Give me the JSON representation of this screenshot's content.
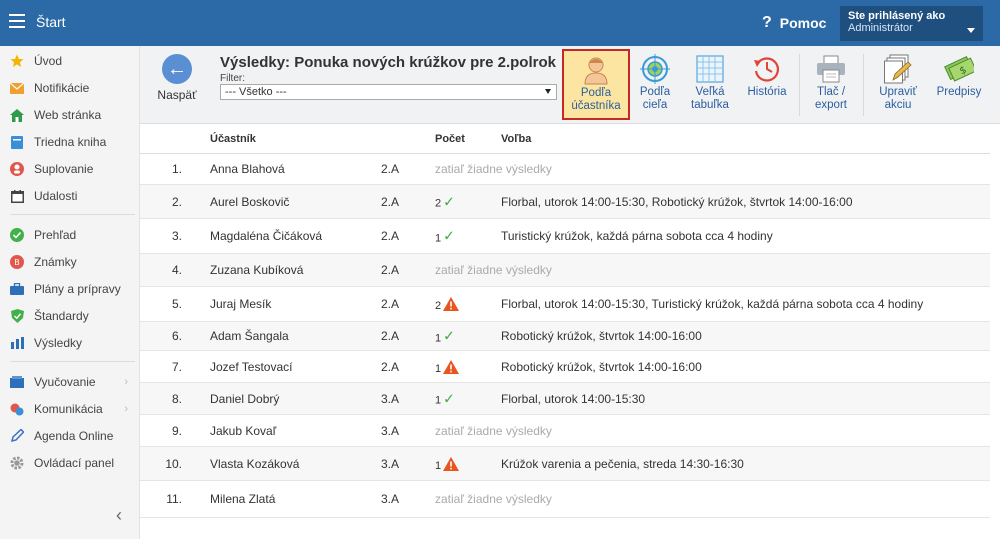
{
  "topbar": {
    "app_title": "Štart",
    "help_label": "Pomoc",
    "user_line1": "Ste prihlásený ako",
    "user_line2": "Administrátor"
  },
  "sidebar": {
    "items": [
      {
        "label": "Úvod",
        "icon": "star-icon"
      },
      {
        "label": "Notifikácie",
        "icon": "envelope-icon"
      },
      {
        "label": "Web stránka",
        "icon": "home-icon"
      },
      {
        "label": "Triedna kniha",
        "icon": "book-icon"
      },
      {
        "label": "Suplovanie",
        "icon": "substitute-icon"
      },
      {
        "label": "Udalosti",
        "icon": "calendar-icon"
      },
      {
        "label": "Prehľad",
        "icon": "check-circle-icon"
      },
      {
        "label": "Známky",
        "icon": "grades-icon"
      },
      {
        "label": "Plány a prípravy",
        "icon": "briefcase-icon"
      },
      {
        "label": "Štandardy",
        "icon": "shield-icon"
      },
      {
        "label": "Výsledky",
        "icon": "bar-chart-icon"
      },
      {
        "label": "Vyučovanie",
        "icon": "teaching-icon"
      },
      {
        "label": "Komunikácia",
        "icon": "chat-icon"
      },
      {
        "label": "Agenda Online",
        "icon": "pen-icon"
      },
      {
        "label": "Ovládací panel",
        "icon": "gear-icon"
      }
    ]
  },
  "toolbar": {
    "back_label": "Naspäť",
    "page_title": "Výsledky: Ponuka nových krúžkov pre 2.polrok",
    "filter_label": "Filter:",
    "filter_value": "--- Všetko ---",
    "buttons": [
      {
        "line1": "Podľa",
        "line2": "účastníka"
      },
      {
        "line1": "Podľa",
        "line2": "cieľa"
      },
      {
        "line1": "Veľká",
        "line2": "tabuľka"
      },
      {
        "line1": "História",
        "line2": ""
      },
      {
        "line1": "Tlač /",
        "line2": "export"
      },
      {
        "line1": "Upraviť",
        "line2": "akciu"
      },
      {
        "line1": "Predpisy",
        "line2": ""
      }
    ]
  },
  "table": {
    "headers": {
      "participant": "Účastník",
      "count": "Počet",
      "choice": "Voľba"
    },
    "rows": [
      {
        "num": "1.",
        "name": "Anna Blahová",
        "cls": "2.A",
        "count": "",
        "status": "none",
        "choice": "zatiaľ žiadne výsledky"
      },
      {
        "num": "2.",
        "name": "Aurel Boskovič",
        "cls": "2.A",
        "count": "2",
        "status": "ok",
        "choice": "Florbal, utorok 14:00-15:30, Robotický krúžok, štvrtok 14:00-16:00"
      },
      {
        "num": "3.",
        "name": "Magdaléna Čičáková",
        "cls": "2.A",
        "count": "1",
        "status": "ok",
        "choice": "Turistický krúžok, každá párna sobota cca 4 hodiny"
      },
      {
        "num": "4.",
        "name": "Zuzana Kubíková",
        "cls": "2.A",
        "count": "",
        "status": "none",
        "choice": "zatiaľ žiadne výsledky"
      },
      {
        "num": "5.",
        "name": "Juraj Mesík",
        "cls": "2.A",
        "count": "2",
        "status": "warn",
        "choice": "Florbal, utorok 14:00-15:30, Turistický krúžok, každá párna sobota cca 4 hodiny"
      },
      {
        "num": "6.",
        "name": "Adam Šangala",
        "cls": "2.A",
        "count": "1",
        "status": "ok",
        "choice": "Robotický krúžok, štvrtok 14:00-16:00"
      },
      {
        "num": "7.",
        "name": "Jozef Testovací",
        "cls": "2.A",
        "count": "1",
        "status": "warn",
        "choice": "Robotický krúžok, štvrtok 14:00-16:00"
      },
      {
        "num": "8.",
        "name": "Daniel Dobrý",
        "cls": "3.A",
        "count": "1",
        "status": "ok",
        "choice": "Florbal, utorok 14:00-15:30"
      },
      {
        "num": "9.",
        "name": "Jakub Kovaľ",
        "cls": "3.A",
        "count": "",
        "status": "none",
        "choice": "zatiaľ žiadne výsledky"
      },
      {
        "num": "10.",
        "name": "Vlasta Kozáková",
        "cls": "3.A",
        "count": "1",
        "status": "warn",
        "choice": "Krúžok varenia a pečenia, streda 14:30-16:30"
      },
      {
        "num": "11.",
        "name": "Milena Zlatá",
        "cls": "3.A",
        "count": "",
        "status": "none",
        "choice": "zatiaľ žiadne výsledky"
      }
    ]
  }
}
